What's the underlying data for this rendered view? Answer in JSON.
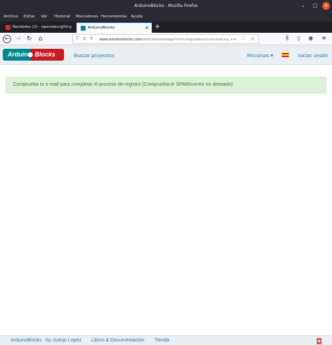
{
  "window": {
    "title": "ArduinoBlocks - Mozilla Firefox",
    "minimize_glyph": "⌄",
    "maximize_glyph": "□",
    "close_glyph": "×"
  },
  "menu": [
    "Archivo",
    "Editar",
    "Ver",
    "Historial",
    "Marcadores",
    "Herramientas",
    "Ayuda"
  ],
  "tabs": [
    {
      "label": "Recibidos (2) - openlabcrg00@gma",
      "icon": "gmail-icon",
      "active": false
    },
    {
      "label": "ArduinoBlocks",
      "icon": "arduinoblocks-icon",
      "active": true
    }
  ],
  "newtab_glyph": "+",
  "urlbar": {
    "url_domain": "www.arduinoblocks.com",
    "url_path": "/web/site/message?m=Comprueba+tu+e-mail+p...",
    "menu_dots": "•••"
  },
  "site": {
    "logo_left": "Arduino",
    "logo_right": "Blocks",
    "search_projects": "Buscar proyectos",
    "resources": "Recursos ▾",
    "login": "Iniciar sesión"
  },
  "alert": {
    "message": "Comprueba tu e-mail para completar el proceso de registro (Comprueba el SPAM/correo no deseado)",
    "color": "#3c763d",
    "background": "#dff0d8"
  },
  "footer": {
    "credit": "ArduinoBlocks - by Juanjo Lopez",
    "docs": "Libros & Documentación",
    "store": "Tienda"
  },
  "colors": {
    "accent": "#0a84ff",
    "link": "#2b7bb3",
    "brand_teal": "#00878f",
    "brand_red": "#c61c22"
  }
}
